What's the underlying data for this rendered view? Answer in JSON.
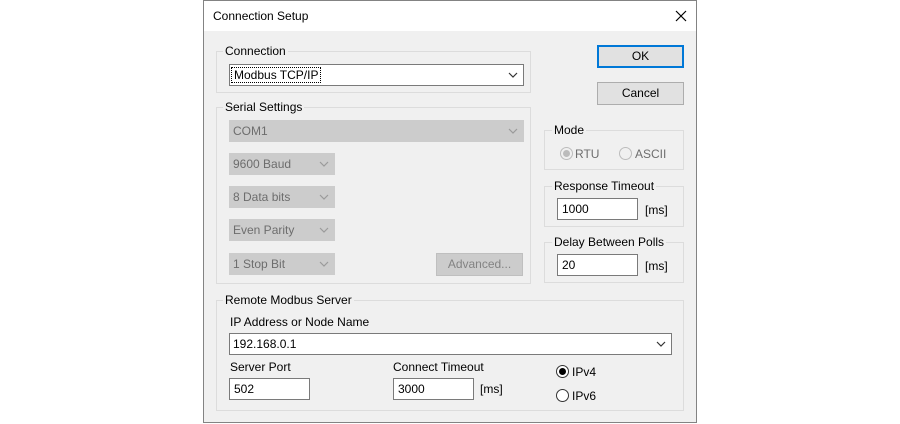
{
  "dialog": {
    "title": "Connection Setup"
  },
  "connection": {
    "label": "Connection",
    "value": "Modbus TCP/IP"
  },
  "buttons": {
    "ok": "OK",
    "cancel": "Cancel",
    "advanced": "Advanced..."
  },
  "serial": {
    "label": "Serial Settings",
    "port": "COM1",
    "baud": "9600 Baud",
    "data_bits": "8 Data bits",
    "parity": "Even Parity",
    "stop_bits": "1 Stop Bit"
  },
  "mode": {
    "label": "Mode",
    "rtu": "RTU",
    "ascii": "ASCII",
    "selected": "RTU"
  },
  "response_timeout": {
    "label": "Response Timeout",
    "value": "1000",
    "unit": "[ms]"
  },
  "delay_between_polls": {
    "label": "Delay Between Polls",
    "value": "20",
    "unit": "[ms]"
  },
  "remote": {
    "label": "Remote Modbus Server",
    "ip_label": "IP Address or Node Name",
    "ip_value": "192.168.0.1",
    "port_label": "Server Port",
    "port_value": "502",
    "connect_timeout_label": "Connect Timeout",
    "connect_timeout_value": "3000",
    "connect_timeout_unit": "[ms]",
    "ipv4": "IPv4",
    "ipv6": "IPv6",
    "selected_ip_version": "IPv4"
  },
  "colors": {
    "default_button_border": "#0078d7",
    "dialog_bg": "#f0f0f0",
    "disabled_bg": "#cccccc"
  }
}
